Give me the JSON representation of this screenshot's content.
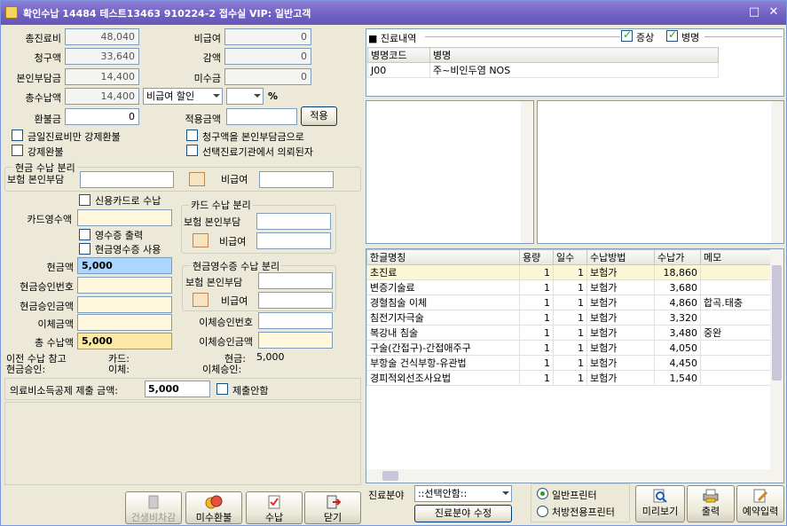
{
  "title": "확인수납 14484 테스트13463 910224-2 접수실 VIP: 일반고객",
  "fields": {
    "total_fee_label": "총진료비",
    "total_fee": "48,040",
    "claim_label": "청구액",
    "claim": "33,640",
    "self_pay_label": "본인부담금",
    "self_pay": "14,400",
    "total_received_label": "총수납액",
    "total_received": "14,400",
    "refund_label": "환불금",
    "refund": "0",
    "noncovered_label": "비급여",
    "noncovered": "0",
    "discount_label": "감액",
    "discount": "0",
    "unpaid_label": "미수금",
    "unpaid": "0",
    "discount_type": "비급여 할인",
    "percent_sign": "%",
    "apply_amount_label": "적용금액",
    "apply_button": "적용"
  },
  "checks": {
    "c1": "금일진료비만 강제환불",
    "c2": "청구액을 본인부담금으로",
    "c3": "강제완불",
    "c4": "선택진료기관에서 의뢰된자"
  },
  "cash_split": {
    "title": "현금 수납 분리",
    "insurance_label": "보험 본인부담",
    "noncovered_label": "비급여"
  },
  "card": {
    "credit_check": "신용카드로 수납",
    "card_amount_label": "카드영수액",
    "receipt_print": "영수증 출력",
    "cash_receipt_use": "현금영수증 사용",
    "split_title": "카드 수납 분리",
    "insurance_label": "보험 본인부담",
    "noncovered_label": "비급여"
  },
  "cash": {
    "cash_label": "현금액",
    "cash_value": "5,000",
    "approval_no_label": "현금승인번호",
    "approval_amt_label": "현금승인금액",
    "transfer_label": "이체금액",
    "total_label": "총 수납액",
    "total_value": "5,000",
    "receipt_split_title": "현금영수증 수납 분리",
    "insurance_label": "보험 본인부담",
    "noncovered_label": "비급여",
    "transfer_approval_no_label": "이체승인번호",
    "transfer_approval_amt_label": "이체승인금액"
  },
  "prev": {
    "ref_label": "이전 수납 참고",
    "card_label": "카드:",
    "cash_label": "현금:",
    "cash_value": "5,000",
    "cash_approval_label": "현금승인:",
    "transfer_label": "이체:",
    "transfer_approval_label": "이체승인:"
  },
  "deduction": {
    "label": "의료비소득공제 제출 금액:",
    "value": "5,000",
    "exclude": "제출안함"
  },
  "bottom_buttons": {
    "health_diff": "건생비차감",
    "unpaid_refund": "미수환불",
    "receive": "수납",
    "close": "닫기"
  },
  "diagnosis": {
    "title": "■ 진료내역",
    "symptom": "증상",
    "disease": "병명",
    "headers": [
      "병명코드",
      "병명"
    ],
    "rows": [
      [
        "J00",
        "주~비인두염 NOS"
      ]
    ]
  },
  "items": {
    "headers": [
      "한글명칭",
      "용량",
      "일수",
      "수납방법",
      "수납가",
      "메모"
    ],
    "rows": [
      [
        "초진료",
        "1",
        "1",
        "보험가",
        "18,860",
        ""
      ],
      [
        "변증기술료",
        "1",
        "1",
        "보험가",
        "3,680",
        ""
      ],
      [
        "경혈침술 이체",
        "1",
        "1",
        "보험가",
        "4,860",
        "합곡.태충"
      ],
      [
        "침전기자극술",
        "1",
        "1",
        "보험가",
        "3,320",
        ""
      ],
      [
        "복강내 침술",
        "1",
        "1",
        "보험가",
        "3,480",
        "중완"
      ],
      [
        "구술(간접구)-간접애주구",
        "1",
        "1",
        "보험가",
        "4,050",
        ""
      ],
      [
        "부항술 건식부항-유관법",
        "1",
        "1",
        "보험가",
        "4,450",
        ""
      ],
      [
        "경피적외선조사요법",
        "1",
        "1",
        "보험가",
        "1,540",
        ""
      ]
    ]
  },
  "footer": {
    "field_label": "진료분야",
    "field_select": "::선택안함::",
    "field_edit": "진료분야 수정",
    "printer_normal": "일반프린터",
    "printer_rx": "처방전용프린터",
    "preview": "미리보기",
    "print": "출력",
    "reserve": "예약입력"
  }
}
